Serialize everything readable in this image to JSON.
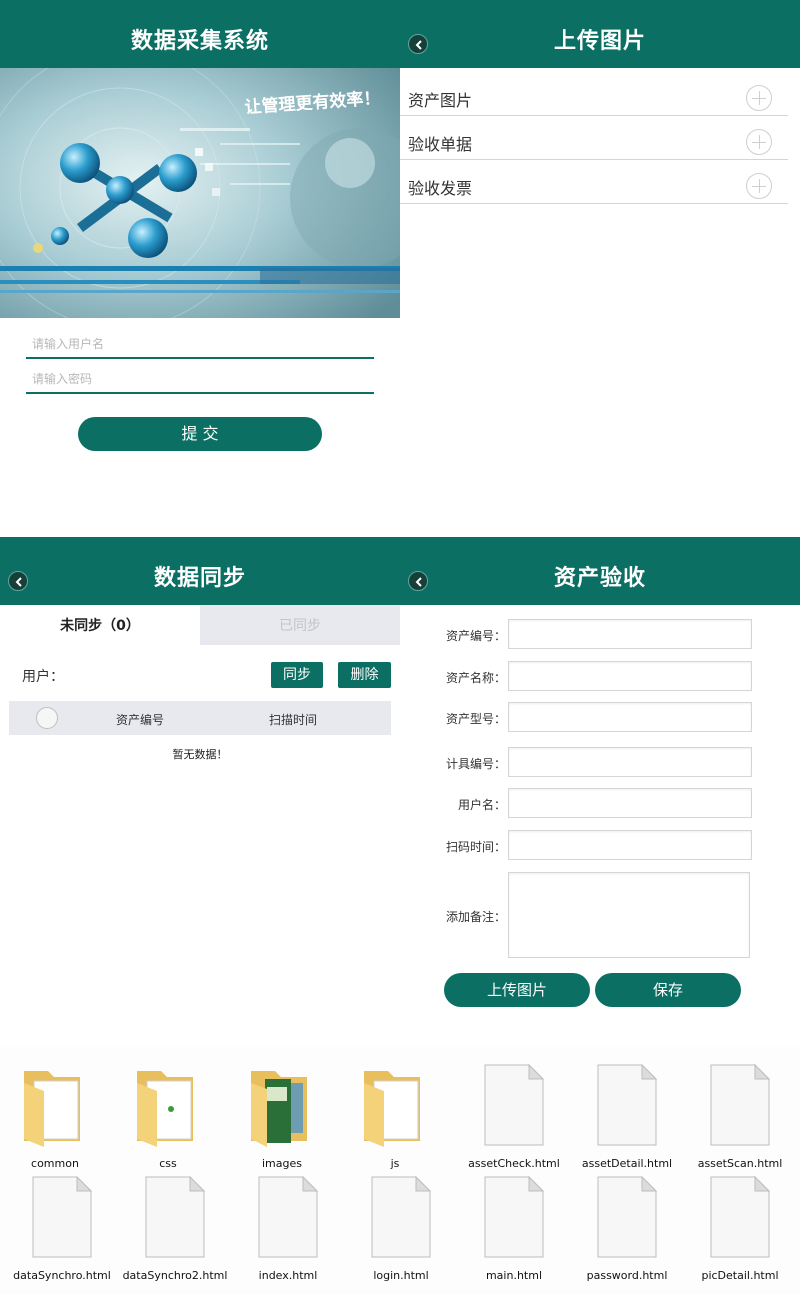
{
  "login": {
    "title": "数据采集系统",
    "hero_slogan": "让管理更有效率！",
    "username_placeholder": "请输入用户名",
    "password_placeholder": "请输入密码",
    "submit_label": "提 交"
  },
  "upload": {
    "title": "上传图片",
    "rows": [
      {
        "label": "资产图片"
      },
      {
        "label": "验收单据"
      },
      {
        "label": "验收发票"
      }
    ]
  },
  "sync": {
    "title": "数据同步",
    "tab_unsynced": "未同步（0）",
    "tab_synced": "已同步",
    "user_label": "用户：",
    "sync_button": "同步",
    "delete_button": "删除",
    "columns": [
      "资产编号",
      "扫描时间"
    ],
    "empty_text": "暂无数据！"
  },
  "check": {
    "title": "资产验收",
    "fields": [
      {
        "label": "资产编号："
      },
      {
        "label": "资产名称："
      },
      {
        "label": "资产型号："
      },
      {
        "label": "计具编号："
      },
      {
        "label": "用户名："
      },
      {
        "label": "扫码时间："
      }
    ],
    "remark_label": "添加备注：",
    "upload_button": "上传图片",
    "save_button": "保存"
  },
  "explorer": {
    "files": [
      {
        "name": "common",
        "kind": "folder"
      },
      {
        "name": "css",
        "kind": "folder"
      },
      {
        "name": "images",
        "kind": "folder"
      },
      {
        "name": "js",
        "kind": "folder"
      },
      {
        "name": "assetCheck.html",
        "kind": "file"
      },
      {
        "name": "assetDetail.html",
        "kind": "file"
      },
      {
        "name": "assetScan.html",
        "kind": "file"
      },
      {
        "name": "dataSynchro.html",
        "kind": "file"
      },
      {
        "name": "dataSynchro2.html",
        "kind": "file"
      },
      {
        "name": "index.html",
        "kind": "file"
      },
      {
        "name": "login.html",
        "kind": "file"
      },
      {
        "name": "main.html",
        "kind": "file"
      },
      {
        "name": "password.html",
        "kind": "file"
      },
      {
        "name": "picDetail.html",
        "kind": "file"
      }
    ]
  },
  "colors": {
    "primary": "#0b6f63",
    "tab_inactive_bg": "#e7e9ef",
    "hero_bg": "#9fc3cc",
    "folder": "#f3d27a"
  }
}
